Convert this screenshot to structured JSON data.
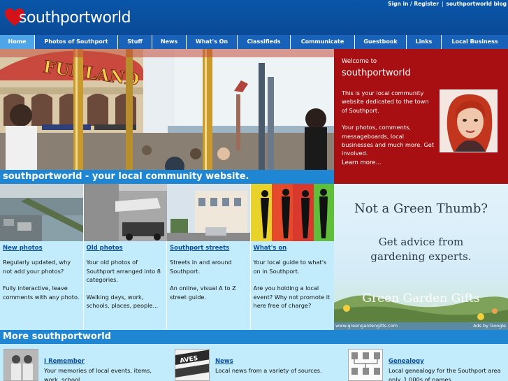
{
  "header": {
    "logo_text": "southportworld",
    "links": [
      "Sign in / Register",
      "southportworld blog"
    ]
  },
  "nav": {
    "items": [
      "Home",
      "Photos of Southport",
      "Stuff",
      "News",
      "What's On",
      "Classifieds",
      "Communicate",
      "Guestbook",
      "Links",
      "Local Business"
    ],
    "active": "Home"
  },
  "hero": {
    "sign_text": "FUNLAND",
    "tagline": "southportworld - your local community website."
  },
  "welcome": {
    "pre": "Welcome to",
    "title": "southportworld",
    "desc1": "This is your local community website dedicated to the town of Southport.",
    "desc2": "Your photos, comments, messageboards, local businesses and much more. Get involved.",
    "learn_more": "Learn more..."
  },
  "ad": {
    "headline": "Not a Green Thumb?",
    "subline": "Get advice from gardening experts.",
    "brand": "Green Garden Gifts",
    "url": "www.greengardengifts.com",
    "ads_by": "Ads by Google"
  },
  "tiles": [
    {
      "title": "New photos",
      "p1": "Regularly updated, why not add your photos?",
      "p2": "Fully interactive, leave comments with any photo."
    },
    {
      "title": "Old photos",
      "p1": "Your old photos of Southport arranged into 8 categories.",
      "p2": "Walking days, work, schools, places, people..."
    },
    {
      "title": "Southport streets",
      "p1": "Streets in and around Southport.",
      "p2": "An online, visual A to Z street guide."
    },
    {
      "title": "What's on",
      "p1": "Your local guide to what's on in Southport.",
      "p2": "Are you holding a local event? Why not promote it here free of charge?"
    }
  ],
  "more": {
    "title": "More southportworld",
    "items": [
      {
        "title": "I Remember",
        "desc": "Your memories of local events, items, work, school..."
      },
      {
        "title": "News",
        "desc": "Local news from a variety of sources."
      },
      {
        "title": "Genealogy",
        "desc": "Local genealogy for the Southport area only. 1,000s of names..."
      }
    ]
  },
  "colors": {
    "header": "#0a4a97",
    "nav": "#1863b9",
    "nav_active": "#4ea5e8",
    "bar": "#1f86d3",
    "welcome_bg": "#a70f12",
    "tile_bg": "#c2ecfb"
  }
}
